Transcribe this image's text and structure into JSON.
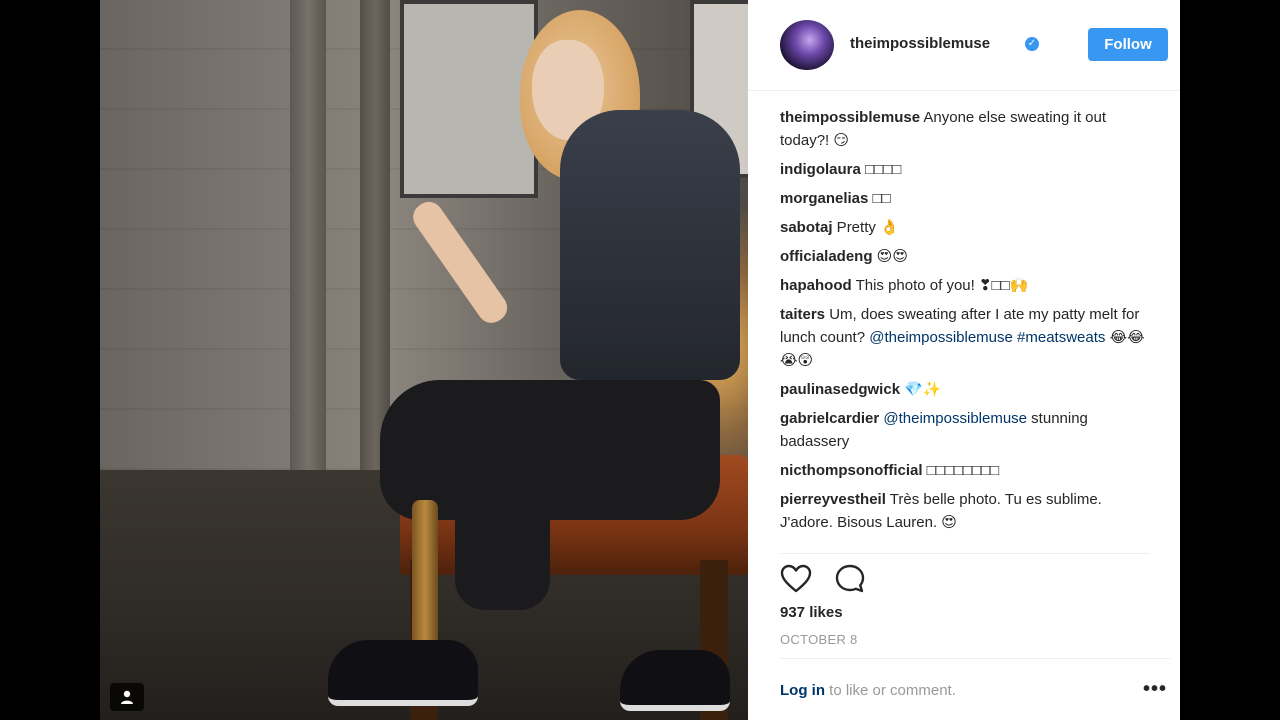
{
  "post": {
    "username": "theimpossiblemuse",
    "follow_label": "Follow",
    "likes": "937 likes",
    "date": "OCTOBER 8",
    "login_link": "Log in",
    "login_rest": " to like or comment.",
    "more_label": "•••"
  },
  "comments": [
    {
      "user": "theimpossiblemuse",
      "text": " Anyone else sweating it out today?! 😏",
      "mention": "",
      "after": ""
    },
    {
      "user": "indigolaura",
      "text": " □□□□",
      "mention": "",
      "after": ""
    },
    {
      "user": "morganelias",
      "text": " □□",
      "mention": "",
      "after": ""
    },
    {
      "user": "sabotaj",
      "text": " Pretty 👌",
      "mention": "",
      "after": ""
    },
    {
      "user": "officialadeng",
      "text": " 😍😍",
      "mention": "",
      "after": ""
    },
    {
      "user": "hapahood",
      "text": " This photo of you! ❣□□🙌",
      "mention": "",
      "after": ""
    },
    {
      "user": "taiters",
      "text": " Um, does sweating after I ate my patty melt for lunch count? ",
      "mention": "@theimpossiblemuse #meatsweats",
      "after": " 😂😂😭😲"
    },
    {
      "user": "paulinasedgwick",
      "text": " 💎✨",
      "mention": "",
      "after": ""
    },
    {
      "user": "gabrielcardier",
      "text": " ",
      "mention": "@theimpossiblemuse",
      "after": " stunning badassery"
    },
    {
      "user": "nicthompsonofficial",
      "text": " □□□□□□□□",
      "mention": "",
      "after": ""
    },
    {
      "user": "pierreyvestheil",
      "text": " Très belle photo. Tu es sublime. J'adore. Bisous Lauren. 😍",
      "mention": "",
      "after": ""
    }
  ],
  "icons": {
    "like": "heart-icon",
    "comment": "comment-icon",
    "user_tag": "user-tag-icon"
  },
  "colors": {
    "accent": "#3897f0",
    "link": "#003569",
    "muted": "#999999"
  }
}
